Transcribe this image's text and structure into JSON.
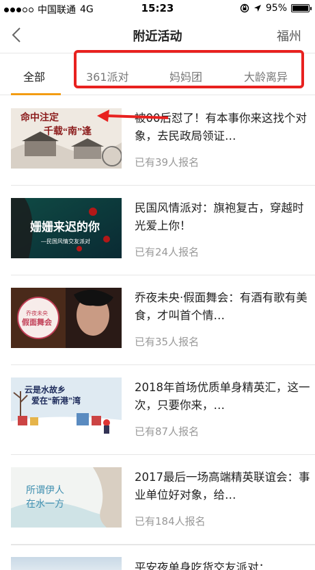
{
  "status_bar": {
    "carrier": "中国联通",
    "network": "4G",
    "time": "15:23",
    "battery": "95%"
  },
  "nav": {
    "title": "附近活动",
    "city": "福州"
  },
  "tabs": [
    {
      "label": "全部",
      "active": true
    },
    {
      "label": "361派对",
      "active": false
    },
    {
      "label": "妈妈团",
      "active": false
    },
    {
      "label": "大龄离异",
      "active": false
    }
  ],
  "events": [
    {
      "title": "被00后怼了！有本事你来这找个对象，去民政局领证…",
      "count": "已有39人报名",
      "thumb_text": [
        "命中注定",
        "千载“南”逢"
      ]
    },
    {
      "title": "民国风情派对：旗袍复古，穿越时光爱上你！",
      "count": "已有24人报名",
      "thumb_text": [
        "姗姗来迟的你",
        "—民国风情交友派对"
      ]
    },
    {
      "title": "乔夜未央·假面舞会：有酒有歌有美食，才叫首个情…",
      "count": "已有35人报名",
      "thumb_text": [
        "乔夜未央",
        "假面舞会"
      ]
    },
    {
      "title": "2018年首场优质单身精英汇，这一次，只要你来，…",
      "count": "已有87人报名",
      "thumb_text": [
        "云是水故乡",
        "爱在“新港”湾"
      ]
    },
    {
      "title": "2017最后一场高端精英联谊会：事业单位好对象，给…",
      "count": "已有184人报名",
      "thumb_text": [
        "所谓伊人",
        "在水一方"
      ]
    }
  ],
  "partial_event": {
    "title": "平安夜单身吃货交友派对："
  },
  "colors": {
    "accent": "#f39c12",
    "annotation": "#e8211f"
  }
}
